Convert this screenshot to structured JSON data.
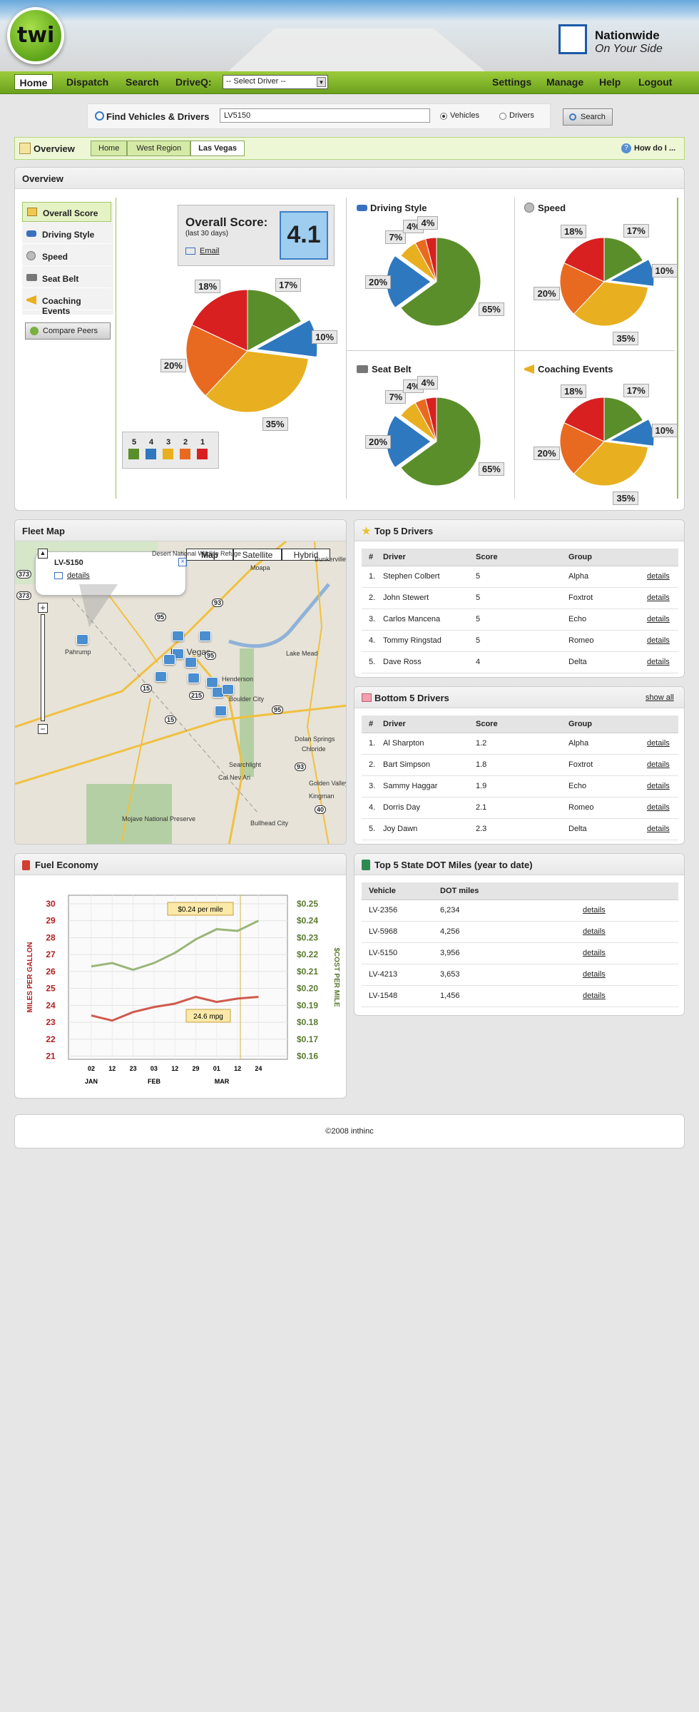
{
  "brand": {
    "logo_text": "twi",
    "partner_name": "Nationwide",
    "partner_tagline": "On Your Side"
  },
  "nav": {
    "home": "Home",
    "dispatch": "Dispatch",
    "search": "Search",
    "driveq": "DriveQ:",
    "driver_select": "-- Select Driver --",
    "settings": "Settings",
    "manage": "Manage",
    "help": "Help",
    "logout": "Logout"
  },
  "find": {
    "label": "Find Vehicles & Drivers",
    "value": "LV5150",
    "radio_vehicles": "Vehicles",
    "radio_drivers": "Drivers",
    "search_button": "Search"
  },
  "breadcrumb": {
    "section": "Overview",
    "items": [
      "Home",
      "West Region",
      "Las Vegas"
    ],
    "howdoi": "How do I ..."
  },
  "overview": {
    "title": "Overview",
    "menu": [
      "Overall Score",
      "Driving Style",
      "Speed",
      "Seat Belt",
      "Coaching Events"
    ],
    "compare_button": "Compare Peers",
    "score_title": "Overall Score:",
    "score_period": "(last 30 days)",
    "score_value": "4.1",
    "email_link": "Email",
    "legend": [
      "5",
      "4",
      "3",
      "2",
      "1"
    ],
    "legend_colors": [
      "#5a8e2a",
      "#2e78c0",
      "#e8b020",
      "#e86a20",
      "#d82020"
    ],
    "pies": [
      {
        "title": "",
        "slices": [
          {
            "label": "17%",
            "value": 17,
            "color": "#5a8e2a"
          },
          {
            "label": "10%",
            "value": 10,
            "color": "#2e78c0"
          },
          {
            "label": "35%",
            "value": 35,
            "color": "#e8b020"
          },
          {
            "label": "20%",
            "value": 20,
            "color": "#e86a20"
          },
          {
            "label": "18%",
            "value": 18,
            "color": "#d82020"
          }
        ]
      },
      {
        "title": "Driving Style",
        "slices": [
          {
            "label": "65%",
            "value": 65,
            "color": "#5a8e2a"
          },
          {
            "label": "20%",
            "value": 20,
            "color": "#2e78c0"
          },
          {
            "label": "7%",
            "value": 7,
            "color": "#e8b020"
          },
          {
            "label": "4%",
            "value": 4,
            "color": "#e86a20"
          },
          {
            "label": "4%",
            "value": 4,
            "color": "#d82020"
          }
        ]
      },
      {
        "title": "Speed",
        "slices": [
          {
            "label": "17%",
            "value": 17,
            "color": "#5a8e2a"
          },
          {
            "label": "10%",
            "value": 10,
            "color": "#2e78c0"
          },
          {
            "label": "35%",
            "value": 35,
            "color": "#e8b020"
          },
          {
            "label": "20%",
            "value": 20,
            "color": "#e86a20"
          },
          {
            "label": "18%",
            "value": 18,
            "color": "#d82020"
          }
        ]
      },
      {
        "title": "Seat Belt",
        "slices": [
          {
            "label": "65%",
            "value": 65,
            "color": "#5a8e2a"
          },
          {
            "label": "20%",
            "value": 20,
            "color": "#2e78c0"
          },
          {
            "label": "7%",
            "value": 7,
            "color": "#e8b020"
          },
          {
            "label": "4%",
            "value": 4,
            "color": "#e86a20"
          },
          {
            "label": "4%",
            "value": 4,
            "color": "#d82020"
          }
        ]
      },
      {
        "title": "Coaching Events",
        "slices": [
          {
            "label": "17%",
            "value": 17,
            "color": "#5a8e2a"
          },
          {
            "label": "10%",
            "value": 10,
            "color": "#2e78c0"
          },
          {
            "label": "35%",
            "value": 35,
            "color": "#e8b020"
          },
          {
            "label": "20%",
            "value": 20,
            "color": "#e86a20"
          },
          {
            "label": "18%",
            "value": 18,
            "color": "#d82020"
          }
        ]
      }
    ]
  },
  "fleetmap": {
    "title": "Fleet Map",
    "buttons": [
      "Map",
      "Satellite",
      "Hybrid"
    ],
    "popup_vehicle": "LV-5150",
    "popup_link": "details",
    "places": [
      "Desert National Wildlife Refuge",
      "Moapa",
      "Bunkerville",
      "Las Vegas",
      "Lake Mead",
      "Henderson",
      "Boulder City",
      "Dolan Springs",
      "Chloride",
      "Searchlight",
      "Cal Nev Ari",
      "Golden Valley",
      "Kingman",
      "Bullhead City",
      "Mojave National Preserve",
      "Pahrump"
    ],
    "highways": [
      "373",
      "373",
      "95",
      "93",
      "95",
      "15",
      "215",
      "95",
      "93",
      "40",
      "15"
    ]
  },
  "top5": {
    "title": "Top 5 Drivers",
    "columns": [
      "#",
      "Driver",
      "Score",
      "Group",
      ""
    ],
    "rows": [
      [
        "1.",
        "Stephen Colbert",
        "5",
        "Alpha",
        "details"
      ],
      [
        "2.",
        "John Stewert",
        "5",
        "Foxtrot",
        "details"
      ],
      [
        "3.",
        "Carlos Mancena",
        "5",
        "Echo",
        "details"
      ],
      [
        "4.",
        "Tommy Ringstad",
        "5",
        "Romeo",
        "details"
      ],
      [
        "5.",
        "Dave Ross",
        "4",
        "Delta",
        "details"
      ]
    ]
  },
  "bottom5": {
    "title": "Bottom 5 Drivers",
    "show_all": "show all",
    "columns": [
      "#",
      "Driver",
      "Score",
      "Group",
      ""
    ],
    "rows": [
      [
        "1.",
        "Al Sharpton",
        "1.2",
        "Alpha",
        "details"
      ],
      [
        "2.",
        "Bart Simpson",
        "1.8",
        "Foxtrot",
        "details"
      ],
      [
        "3.",
        "Sammy Haggar",
        "1.9",
        "Echo",
        "details"
      ],
      [
        "4.",
        "Dorris Day",
        "2.1",
        "Romeo",
        "details"
      ],
      [
        "5.",
        "Joy Dawn",
        "2.3",
        "Delta",
        "details"
      ]
    ]
  },
  "dot": {
    "title": "Top 5 State DOT Miles (year to date)",
    "columns": [
      "Vehicle",
      "DOT miles",
      ""
    ],
    "rows": [
      [
        "LV-2356",
        "6,234",
        "details"
      ],
      [
        "LV-5968",
        "4,256",
        "details"
      ],
      [
        "LV-5150",
        "3,956",
        "details"
      ],
      [
        "LV-4213",
        "3,653",
        "details"
      ],
      [
        "LV-1548",
        "1,456",
        "details"
      ]
    ]
  },
  "fuel": {
    "title": "Fuel Economy",
    "left_axis_title": "MILES PER GALLON",
    "right_axis_title": "$COST PER MILE",
    "tooltip_cost": "$0.24 per mile",
    "tooltip_mpg": "24.6 mpg"
  },
  "chart_data": {
    "type": "line",
    "title": "Fuel Economy",
    "x": [
      "02",
      "12",
      "23",
      "03",
      "12",
      "29",
      "01",
      "12",
      "24"
    ],
    "x_groups": [
      "JAN",
      "FEB",
      "MAR"
    ],
    "ylabel": "MILES PER GALLON",
    "y2label": "$COST PER MILE",
    "ylim": [
      21,
      30
    ],
    "y2lim": [
      0.16,
      0.25
    ],
    "y_ticks": [
      "30",
      "29",
      "28",
      "27",
      "26",
      "25",
      "24",
      "23",
      "22",
      "21"
    ],
    "y2_ticks": [
      "$0.25",
      "$0.24",
      "$0.23",
      "$0.22",
      "$0.21",
      "$0.20",
      "$0.19",
      "$0.18",
      "$0.17",
      "$0.16"
    ],
    "series": [
      {
        "name": "",
        "axis": "right",
        "color": "#9bb57a",
        "values": [
          0.213,
          0.215,
          0.211,
          0.215,
          0.221,
          0.229,
          0.235,
          0.234,
          0.24
        ]
      },
      {
        "name": "",
        "axis": "left",
        "color": "#d05a4c",
        "values": [
          23.4,
          23.1,
          23.6,
          23.9,
          24.1,
          24.5,
          24.2,
          24.4,
          24.5
        ]
      }
    ],
    "grid": true
  },
  "footer": {
    "copyright": "©2008 inthinc"
  }
}
